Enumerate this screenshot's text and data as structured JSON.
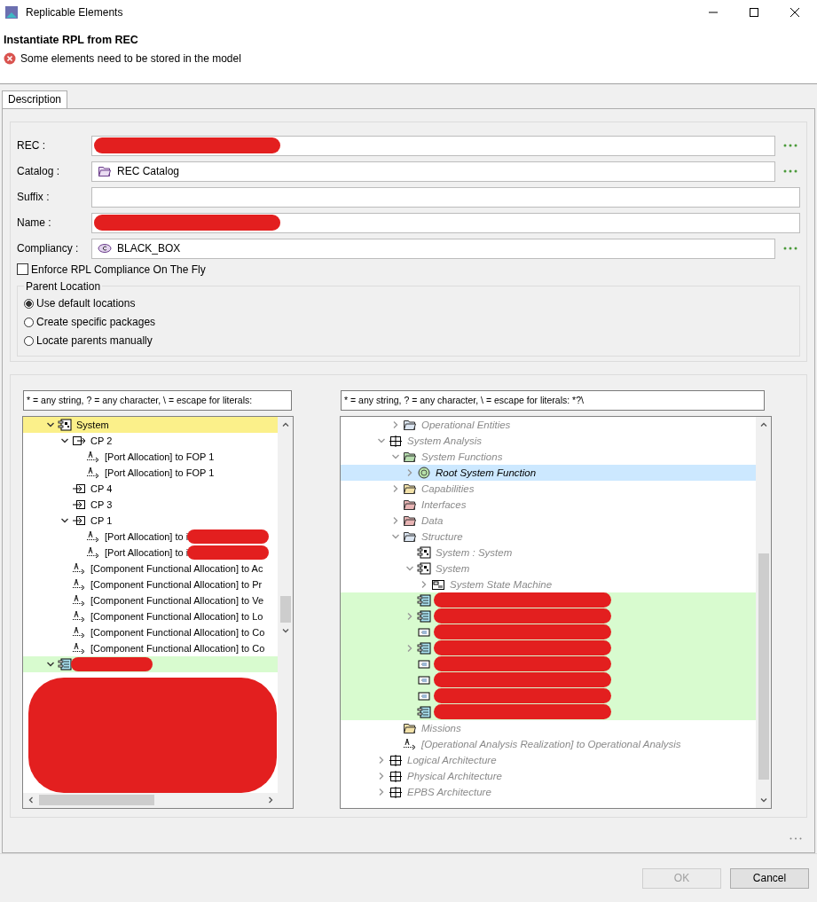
{
  "window": {
    "title": "Replicable Elements"
  },
  "header": {
    "title": "Instantiate RPL from REC",
    "message": "Some elements need to be stored in the model"
  },
  "tabs": [
    {
      "label": "Description",
      "selected": true
    }
  ],
  "fields": [
    {
      "label": "REC :",
      "redacted": true,
      "browse": true,
      "kind": "text"
    },
    {
      "label": "Catalog :",
      "value": "REC Catalog",
      "redacted": false,
      "browse": true,
      "kind": "folder"
    },
    {
      "label": "Suffix :",
      "redacted": false,
      "browse": false,
      "kind": "text"
    },
    {
      "label": "Name :",
      "redacted": true,
      "browse": false,
      "kind": "text"
    },
    {
      "label": "Compliancy :",
      "value": "BLACK_BOX",
      "redacted": false,
      "browse": true,
      "kind": "class"
    }
  ],
  "enforce_checkbox": {
    "label": "Enforce RPL Compliance On The Fly",
    "checked": false
  },
  "parent_location": {
    "title": "Parent Location",
    "options": [
      {
        "label": "Use default locations",
        "selected": true
      },
      {
        "label": "Create specific packages",
        "selected": false
      },
      {
        "label": "Locate parents manually",
        "selected": false
      }
    ]
  },
  "left_tree": {
    "filter": "* = any string, ? = any character, \\ = escape for literals:",
    "redacted_area": true,
    "items": [
      {
        "label": "System",
        "kind": "component",
        "expanded": true,
        "color": "#fbf08a",
        "selected": false,
        "children": [
          {
            "label": "CP 2",
            "kind": "port_out",
            "expanded": true,
            "selected": false,
            "children": [
              {
                "label": "[Port Allocation] to FOP 1",
                "kind": "allocation",
                "selected": false
              },
              {
                "label": "[Port Allocation] to FOP 1",
                "kind": "allocation",
                "selected": false
              }
            ]
          },
          {
            "label": "CP 4",
            "kind": "port_in",
            "selected": false
          },
          {
            "label": "CP 3",
            "kind": "port_in",
            "selected": false
          },
          {
            "label": "CP 1",
            "kind": "port_in",
            "expanded": true,
            "selected": false,
            "children": [
              {
                "label": "[Port Allocation] to i",
                "kind": "allocation",
                "redacted": true,
                "selected": false
              },
              {
                "label": "[Port Allocation] to i",
                "kind": "allocation",
                "redacted": true,
                "selected": false
              }
            ]
          },
          {
            "label": "[Component Functional Allocation] to Ac",
            "kind": "allocation",
            "selected": false
          },
          {
            "label": "[Component Functional Allocation] to Pr",
            "kind": "allocation",
            "selected": false
          },
          {
            "label": "[Component Functional Allocation] to Ve",
            "kind": "allocation",
            "selected": false
          },
          {
            "label": "[Component Functional Allocation] to Lo",
            "kind": "allocation",
            "selected": false
          },
          {
            "label": "[Component Functional Allocation] to Co",
            "kind": "allocation",
            "selected": false
          },
          {
            "label": "[Component Functional Allocation] to Co",
            "kind": "allocation",
            "selected": false
          }
        ]
      },
      {
        "kind": "sa_component",
        "expanded": true,
        "color": "#d8fbcf",
        "redacted": true,
        "selected": false
      }
    ]
  },
  "right_tree": {
    "filter": "* = any string, ? = any character, \\ = escape for literals: *?\\",
    "continued_from_above": [
      {
        "label": "Operational Entities",
        "kind": "folder",
        "color": "#dce6f2",
        "expanded": false,
        "greyed": true,
        "selected": false
      }
    ],
    "items": [
      {
        "label": "System Analysis",
        "kind": "grid",
        "expanded": true,
        "greyed": true,
        "selected": false,
        "children": [
          {
            "label": "System Functions",
            "kind": "folder",
            "color": "#b6dcae",
            "expanded": true,
            "greyed": true,
            "selected": false,
            "children": [
              {
                "label": "Root System Function",
                "kind": "function",
                "expanded": false,
                "greyed": false,
                "selected": true
              }
            ]
          },
          {
            "label": "Capabilities",
            "kind": "folder",
            "color": "#f3e2a9",
            "expanded": false,
            "greyed": true,
            "selected": false
          },
          {
            "label": "Interfaces",
            "kind": "folder",
            "color": "#e8b4b4",
            "greyed": true,
            "selected": false
          },
          {
            "label": "Data",
            "kind": "folder",
            "color": "#e8b4b4",
            "expanded": false,
            "greyed": true,
            "selected": false
          },
          {
            "label": "Structure",
            "kind": "folder",
            "color": "#dce6f2",
            "expanded": true,
            "greyed": true,
            "selected": false,
            "children": [
              {
                "label": "System : System",
                "kind": "component",
                "greyed": true,
                "selected": false
              },
              {
                "label": "System",
                "kind": "component",
                "expanded": true,
                "greyed": true,
                "selected": false,
                "children": [
                  {
                    "label": "System State Machine",
                    "kind": "state_machine",
                    "expanded": false,
                    "greyed": true,
                    "selected": false
                  }
                ]
              },
              {
                "kind": "sa_component",
                "color": "#d8fbcf",
                "redacted": true,
                "selected": false
              },
              {
                "kind": "sa_component",
                "expanded": false,
                "color": "#d8fbcf",
                "redacted": true,
                "selected": false
              },
              {
                "kind": "sa_port",
                "color": "#d8fbcf",
                "redacted": true,
                "selected": false
              },
              {
                "kind": "sa_component",
                "expanded": false,
                "color": "#d8fbcf",
                "redacted": true,
                "selected": false
              },
              {
                "kind": "sa_port",
                "color": "#d8fbcf",
                "redacted": true,
                "selected": false
              },
              {
                "kind": "sa_port",
                "color": "#d8fbcf",
                "redacted": true,
                "selected": false
              },
              {
                "kind": "sa_port",
                "color": "#d8fbcf",
                "redacted": true,
                "selected": false
              },
              {
                "kind": "sa_component",
                "color": "#d8fbcf",
                "redacted": true,
                "selected": false
              }
            ]
          },
          {
            "label": "Missions",
            "kind": "folder",
            "color": "#f3e2a9",
            "greyed": true,
            "selected": false
          },
          {
            "label": "[Operational Analysis Realization] to Operational Analysis",
            "kind": "realization",
            "greyed": true,
            "selected": false
          }
        ]
      },
      {
        "label": "Logical Architecture",
        "kind": "grid",
        "expanded": false,
        "greyed": true,
        "selected": false
      },
      {
        "label": "Physical Architecture",
        "kind": "grid",
        "expanded": false,
        "greyed": true,
        "selected": false
      },
      {
        "label": "EPBS Architecture",
        "kind": "grid",
        "expanded": false,
        "greyed": true,
        "selected": false
      }
    ]
  },
  "buttons": [
    {
      "label": "OK",
      "disabled": true
    },
    {
      "label": "Cancel",
      "disabled": false
    }
  ]
}
